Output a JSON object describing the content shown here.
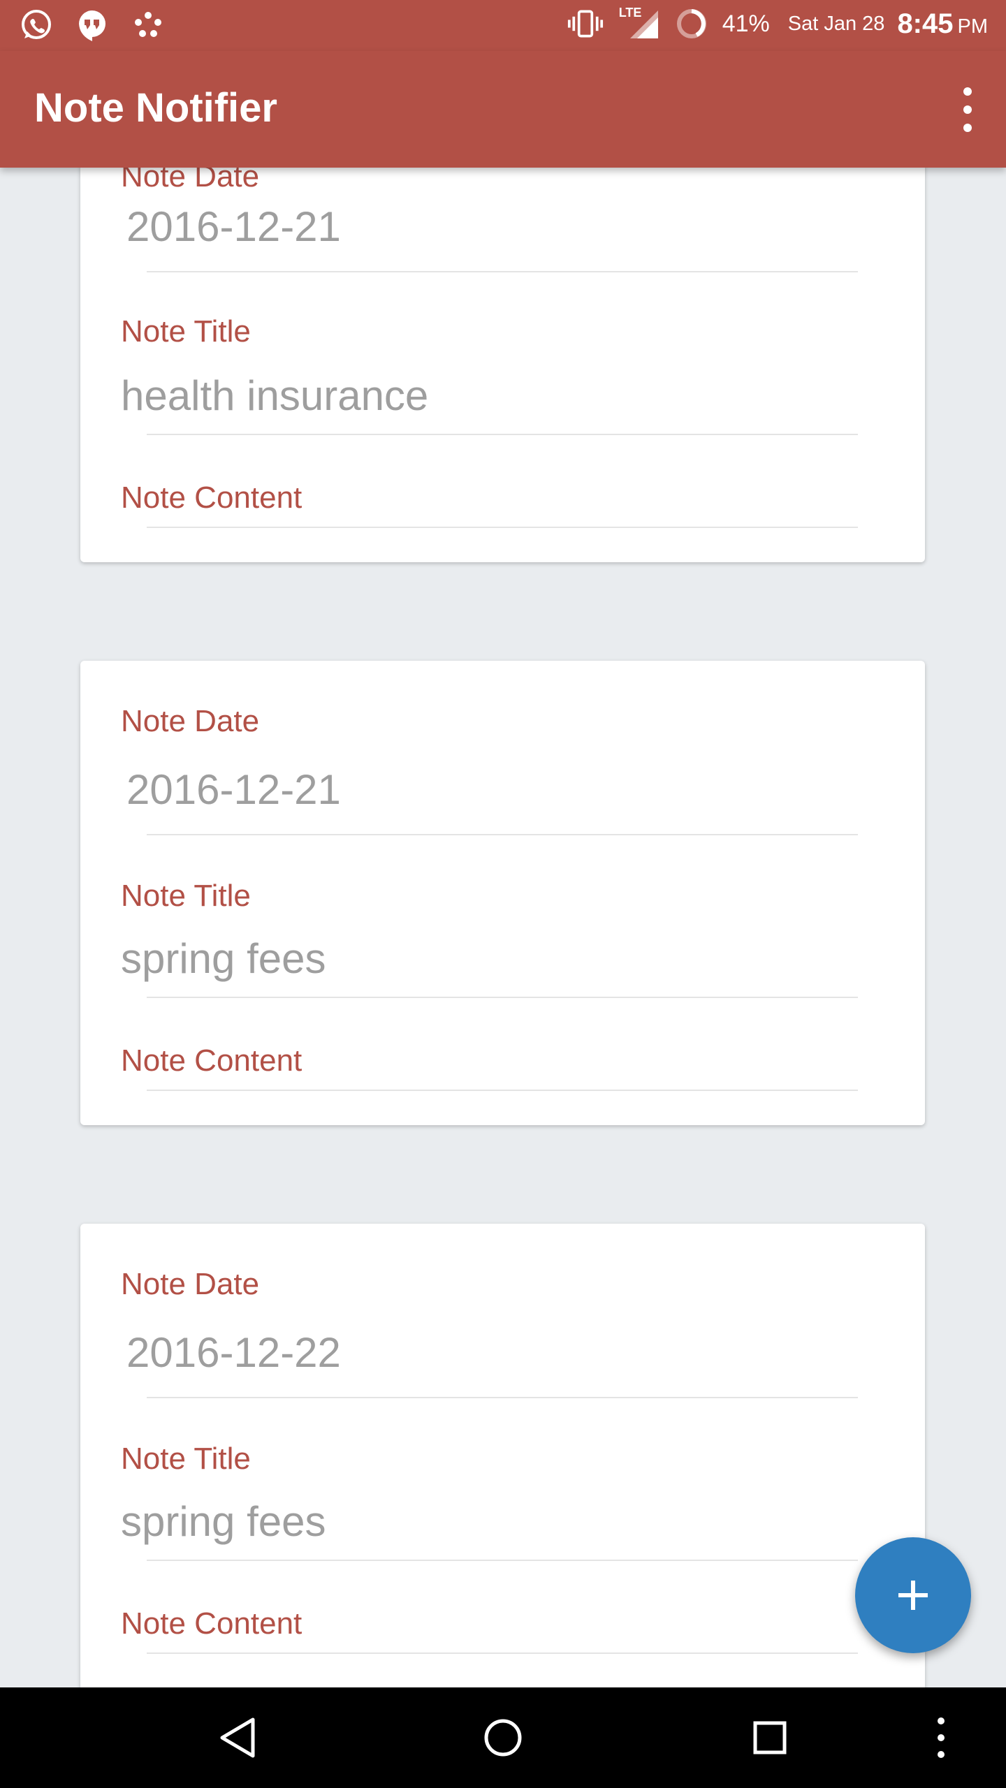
{
  "status_bar": {
    "battery": "41%",
    "date": "Sat Jan 28",
    "time": "8:45",
    "ampm": "PM",
    "network": "LTE"
  },
  "app_bar": {
    "title": "Note Notifier"
  },
  "notes": [
    {
      "date_label": "Note Date",
      "date_value": "2016-12-21",
      "title_label": "Note Title",
      "title_value": "health insurance",
      "content_label": "Note Content",
      "content_value": ""
    },
    {
      "date_label": "Note Date",
      "date_value": "2016-12-21",
      "title_label": "Note Title",
      "title_value": "spring fees",
      "content_label": "Note Content",
      "content_value": ""
    },
    {
      "date_label": "Note Date",
      "date_value": "2016-12-22",
      "title_label": "Note Title",
      "title_value": "spring fees",
      "content_label": "Note Content",
      "content_value": ""
    }
  ],
  "fab": {
    "icon": "plus-icon"
  },
  "colors": {
    "primary": "#b25046",
    "accent": "#2f7fc0",
    "background": "#e9ecef"
  }
}
